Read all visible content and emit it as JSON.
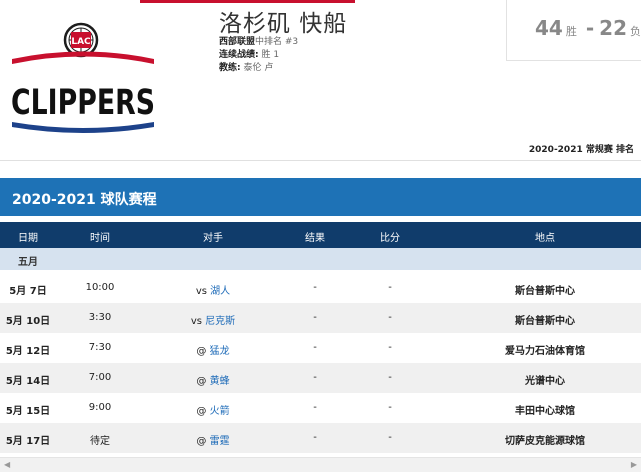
{
  "team": {
    "name": "洛杉矶 快船",
    "logo_text": "CLIPPERS",
    "logo_badge": "LAC",
    "conference_label": "西部联盟",
    "conference_rank": "中排名 #3",
    "streak_label": "连续战绩:",
    "streak_value": "胜 1",
    "coach_label": "教练:",
    "coach_value": "泰伦 卢"
  },
  "record": {
    "wins": "44",
    "wins_unit": "胜",
    "dash": "-",
    "losses": "22",
    "losses_unit": "负"
  },
  "season_label": "2020-2021 常规赛 排名",
  "schedule": {
    "title": "2020-2021 球队赛程",
    "columns": [
      "日期",
      "时间",
      "对手",
      "结果",
      "比分",
      "地点"
    ],
    "month": "五月",
    "rows": [
      {
        "date": "5月 7日",
        "time": "10:00",
        "prefix": "vs",
        "opponent": "湖人",
        "result": "-",
        "score": "-",
        "venue": "斯台普斯中心"
      },
      {
        "date": "5月 10日",
        "time": "3:30",
        "prefix": "vs",
        "opponent": "尼克斯",
        "result": "-",
        "score": "-",
        "venue": "斯台普斯中心"
      },
      {
        "date": "5月 12日",
        "time": "7:30",
        "prefix": "@",
        "opponent": "猛龙",
        "result": "-",
        "score": "-",
        "venue": "爱马力石油体育馆"
      },
      {
        "date": "5月 14日",
        "time": "7:00",
        "prefix": "@",
        "opponent": "黄蜂",
        "result": "-",
        "score": "-",
        "venue": "光谱中心"
      },
      {
        "date": "5月 15日",
        "time": "9:00",
        "prefix": "@",
        "opponent": "火箭",
        "result": "-",
        "score": "-",
        "venue": "丰田中心球馆"
      },
      {
        "date": "5月 17日",
        "time": "待定",
        "prefix": "@",
        "opponent": "雷霆",
        "result": "-",
        "score": "-",
        "venue": "切萨皮克能源球馆"
      }
    ]
  },
  "colors": {
    "brand_red": "#c8102e",
    "brand_blue": "#1d428a",
    "header_blue": "#1e72b6",
    "column_header_navy": "#103c6b",
    "link_blue": "#1e6bb8"
  }
}
